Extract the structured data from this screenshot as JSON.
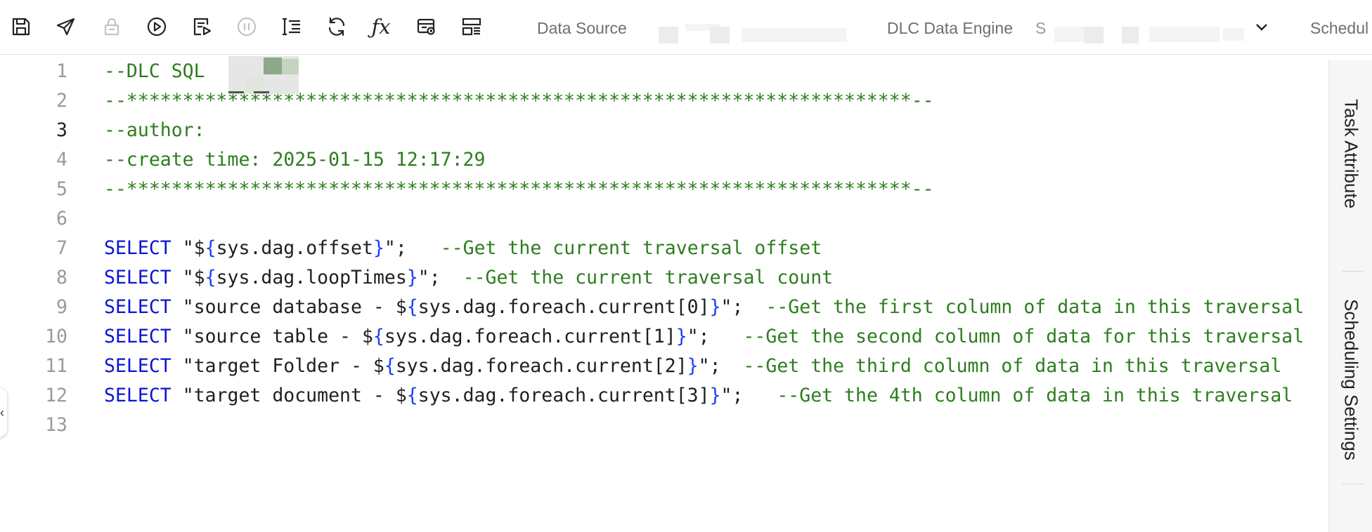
{
  "toolbar": {
    "buttons": [
      {
        "icon": "save-icon"
      },
      {
        "icon": "send-icon"
      },
      {
        "icon": "lock-icon"
      },
      {
        "icon": "run-icon"
      },
      {
        "icon": "run-config-icon"
      },
      {
        "icon": "pause-icon"
      },
      {
        "icon": "format-icon"
      },
      {
        "icon": "refresh-icon"
      },
      {
        "icon": "function-icon",
        "glyph": "ƒx"
      },
      {
        "icon": "test-icon"
      },
      {
        "icon": "layout-icon"
      }
    ],
    "data_source_label": "Data Source",
    "engine_label": "DLC Data Engine",
    "engine_value_prefix": "S",
    "scheduling_label": "Schedul"
  },
  "editor": {
    "active_line": 3,
    "lines": [
      {
        "n": "1",
        "tokens": [
          {
            "t": "cm",
            "v": "--DLC SQL"
          }
        ]
      },
      {
        "n": "2",
        "tokens": [
          {
            "t": "cm",
            "v": "--**********************************************************************--"
          }
        ]
      },
      {
        "n": "3",
        "tokens": [
          {
            "t": "cm",
            "v": "--author: "
          }
        ]
      },
      {
        "n": "4",
        "tokens": [
          {
            "t": "cm",
            "v": "--create time: 2025-01-15 12:17:29"
          }
        ]
      },
      {
        "n": "5",
        "tokens": [
          {
            "t": "cm",
            "v": "--**********************************************************************--"
          }
        ]
      },
      {
        "n": "6",
        "tokens": []
      },
      {
        "n": "7",
        "tokens": [
          {
            "t": "kw",
            "v": "SELECT"
          },
          {
            "t": "str",
            "v": " \"$"
          },
          {
            "t": "br",
            "v": "{"
          },
          {
            "t": "str",
            "v": "sys.dag.offset"
          },
          {
            "t": "br",
            "v": "}"
          },
          {
            "t": "str",
            "v": "\";   "
          },
          {
            "t": "cm",
            "v": "--Get the current traversal offset"
          }
        ]
      },
      {
        "n": "8",
        "tokens": [
          {
            "t": "kw",
            "v": "SELECT"
          },
          {
            "t": "str",
            "v": " \"$"
          },
          {
            "t": "br",
            "v": "{"
          },
          {
            "t": "str",
            "v": "sys.dag.loopTimes"
          },
          {
            "t": "br",
            "v": "}"
          },
          {
            "t": "str",
            "v": "\";  "
          },
          {
            "t": "cm",
            "v": "--Get the current traversal count"
          }
        ]
      },
      {
        "n": "9",
        "tokens": [
          {
            "t": "kw",
            "v": "SELECT"
          },
          {
            "t": "str",
            "v": " \"source database - $"
          },
          {
            "t": "br",
            "v": "{"
          },
          {
            "t": "str",
            "v": "sys.dag.foreach.current[0]"
          },
          {
            "t": "br",
            "v": "}"
          },
          {
            "t": "str",
            "v": "\";  "
          },
          {
            "t": "cm",
            "v": "--Get the first column of data in this traversal"
          }
        ]
      },
      {
        "n": "10",
        "tokens": [
          {
            "t": "kw",
            "v": "SELECT"
          },
          {
            "t": "str",
            "v": " \"source table - $"
          },
          {
            "t": "br",
            "v": "{"
          },
          {
            "t": "str",
            "v": "sys.dag.foreach.current[1]"
          },
          {
            "t": "br",
            "v": "}"
          },
          {
            "t": "str",
            "v": "\";   "
          },
          {
            "t": "cm",
            "v": "--Get the second column of data for this traversal"
          }
        ]
      },
      {
        "n": "11",
        "tokens": [
          {
            "t": "kw",
            "v": "SELECT"
          },
          {
            "t": "str",
            "v": " \"target Folder - $"
          },
          {
            "t": "br",
            "v": "{"
          },
          {
            "t": "str",
            "v": "sys.dag.foreach.current[2]"
          },
          {
            "t": "br",
            "v": "}"
          },
          {
            "t": "str",
            "v": "\";  "
          },
          {
            "t": "cm",
            "v": "--Get the third column of data in this traversal"
          }
        ]
      },
      {
        "n": "12",
        "tokens": [
          {
            "t": "kw",
            "v": "SELECT"
          },
          {
            "t": "str",
            "v": " \"target document - $"
          },
          {
            "t": "br",
            "v": "{"
          },
          {
            "t": "str",
            "v": "sys.dag.foreach.current[3]"
          },
          {
            "t": "br",
            "v": "}"
          },
          {
            "t": "str",
            "v": "\";   "
          },
          {
            "t": "cm",
            "v": "--Get the 4th column of data in this traversal"
          }
        ]
      },
      {
        "n": "13",
        "tokens": []
      }
    ]
  },
  "side_panel": {
    "tabs": [
      {
        "label": "Task Attribute"
      },
      {
        "label": "Scheduling Settings"
      }
    ],
    "collapse_glyph": "‹"
  }
}
